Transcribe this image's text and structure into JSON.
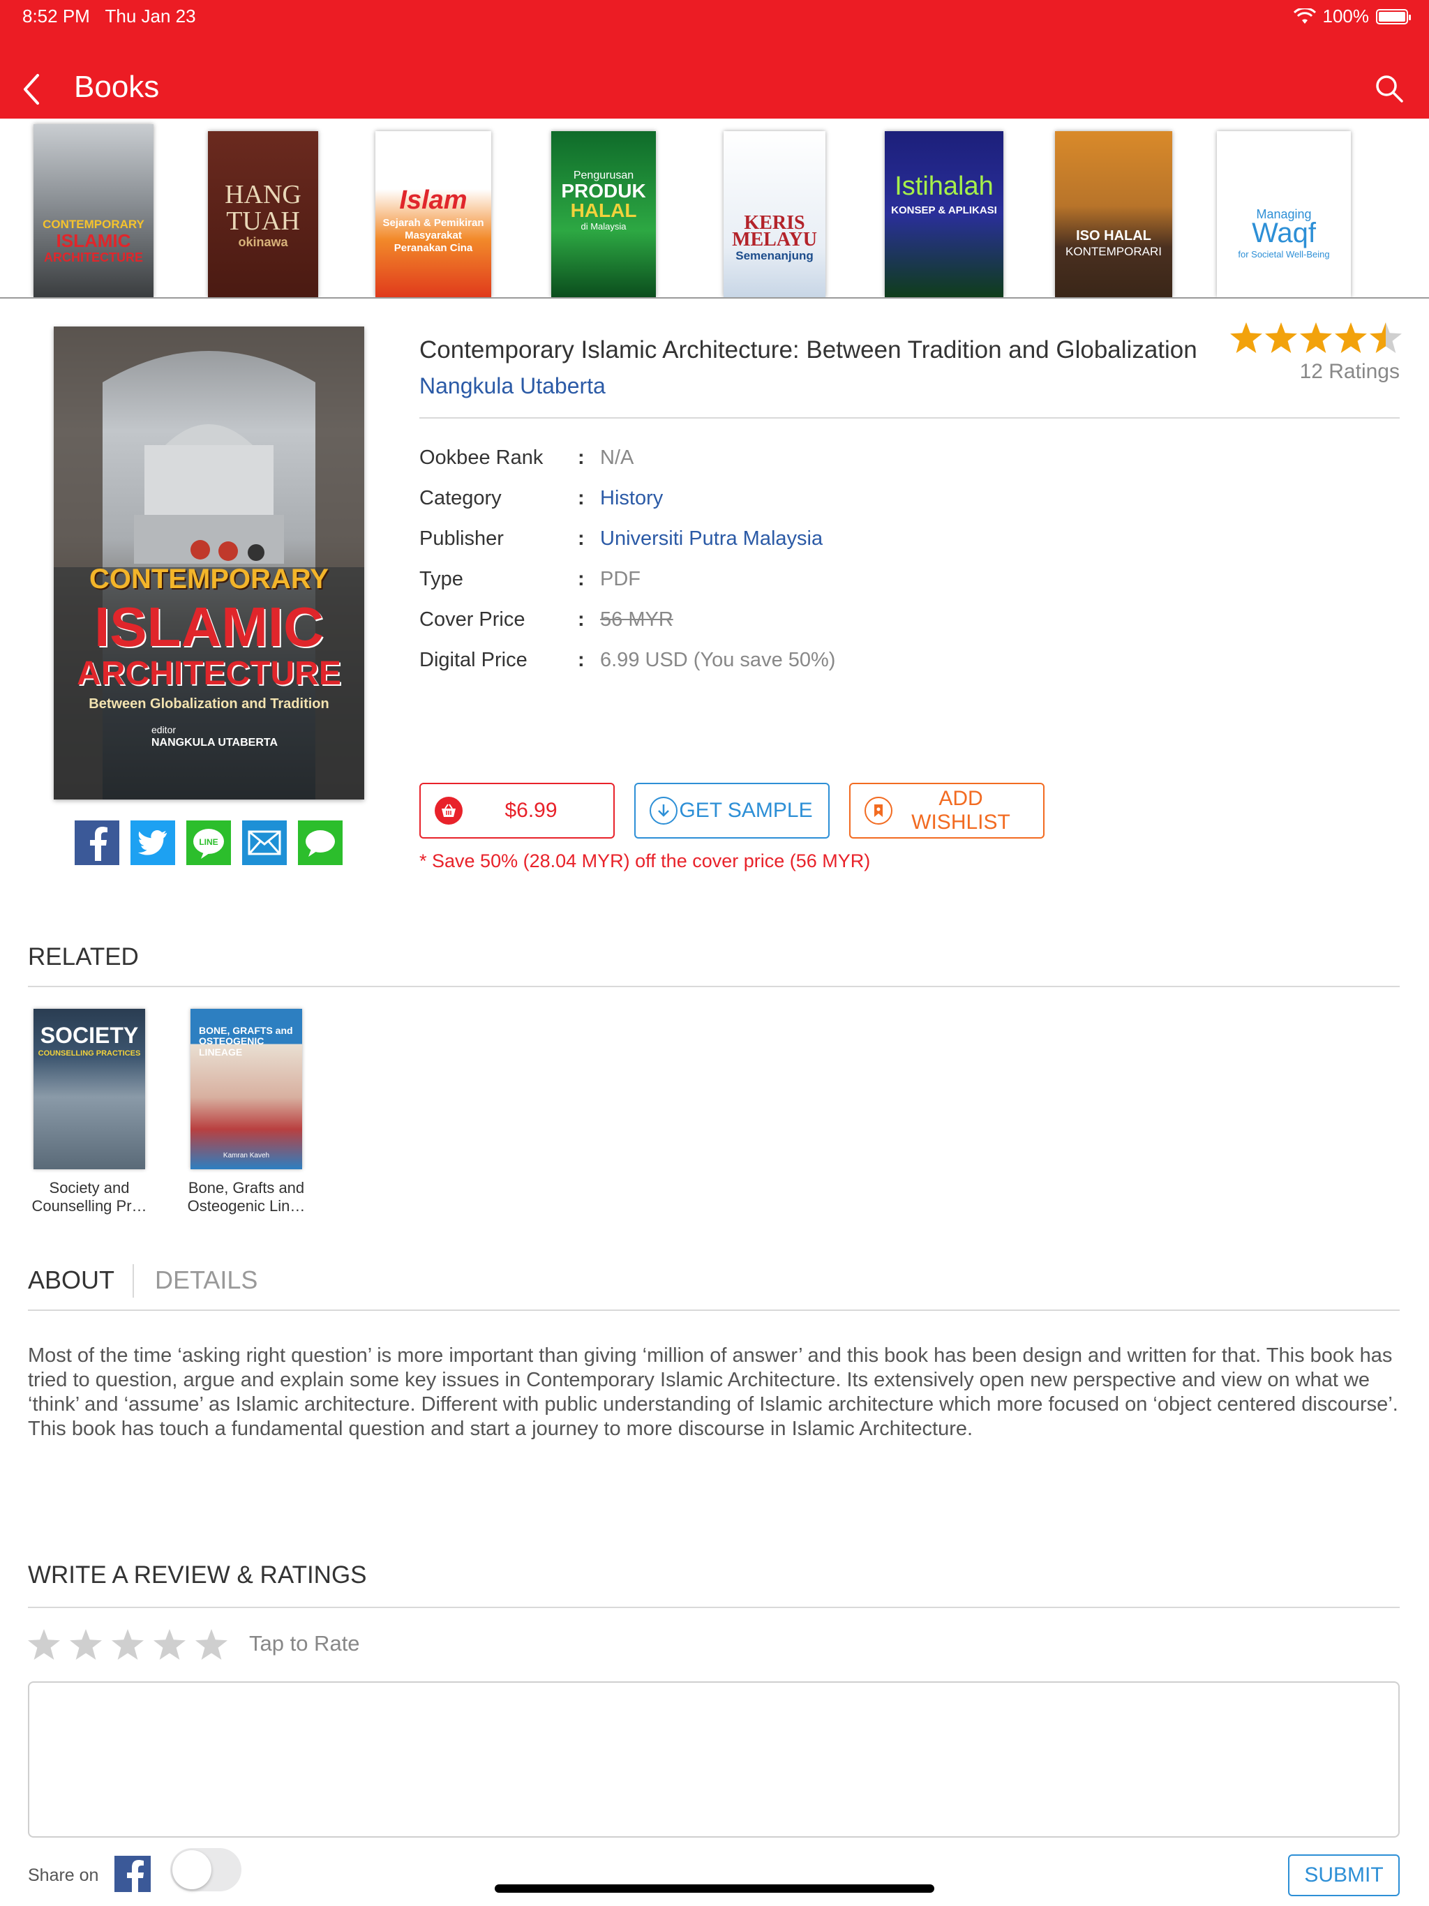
{
  "status_bar": {
    "time": "8:52 PM",
    "date": "Thu Jan 23",
    "battery": "100%"
  },
  "nav": {
    "title": "Books"
  },
  "carousel": [
    {
      "title": "Contemporary Islamic Architecture",
      "lines": [
        "CONTEMPORARY",
        "ISLAMIC",
        "ARCHITECTURE"
      ]
    },
    {
      "title": "Hang Tuah",
      "lines": [
        "HANG",
        "TUAH",
        "okinawa"
      ]
    },
    {
      "title": "Islam Sejarah & Pemikiran",
      "lines": [
        "Islam",
        "Sejarah & Pemikiran",
        "Masyarakat",
        "Peranakan Cina"
      ]
    },
    {
      "title": "Pengurusan Produk Halal",
      "lines": [
        "Pengurusan",
        "PRODUK",
        "HALAL",
        "di Malaysia"
      ]
    },
    {
      "title": "Keris Melayu Semenanjung",
      "lines": [
        "KERIS",
        "MELAYU",
        "Semenanjung"
      ]
    },
    {
      "title": "Istihalah Konsep & Aplikasi",
      "lines": [
        "Istihalah",
        "KONSEP & APLIKASI"
      ]
    },
    {
      "title": "ISO Halal Kontemporari",
      "lines": [
        "ISO HALAL",
        "KONTEMPORARI"
      ]
    },
    {
      "title": "Managing Waqf",
      "lines": [
        "Managing",
        "Waqf",
        "for Societal Well-Being"
      ]
    }
  ],
  "book": {
    "title": "Contemporary Islamic Architecture: Between Tradition and Globalization",
    "author": "Nangkula Utaberta",
    "rating": 4.5,
    "ratings_count": "12 Ratings",
    "cover": {
      "line1": "CONTEMPORARY",
      "line2": "ISLAMIC",
      "line3": "ARCHITECTURE",
      "subtitle": "Between Globalization and Tradition",
      "editor_label": "editor",
      "editor": "NANGKULA UTABERTA"
    },
    "info": [
      {
        "label": "Ookbee Rank",
        "value": "N/A"
      },
      {
        "label": "Category",
        "value": "History"
      },
      {
        "label": "Publisher",
        "value": "Universiti Putra Malaysia"
      },
      {
        "label": "Type",
        "value": "PDF"
      },
      {
        "label": "Cover Price",
        "value": "56 MYR"
      },
      {
        "label": "Digital Price",
        "value": "6.99 USD (You save 50%)"
      }
    ],
    "colon": ":",
    "buy_label": "$6.99",
    "sample_label": "GET SAMPLE",
    "wishlist_label": "ADD WISHLIST",
    "save_note": "* Save 50% (28.04 MYR) off the cover price (56 MYR)"
  },
  "share_icons": [
    "facebook-icon",
    "twitter-icon",
    "line-icon",
    "mail-icon",
    "message-icon"
  ],
  "related": {
    "heading": "RELATED",
    "items": [
      {
        "title_line1": "Society and",
        "title_line2": "Counselling Pr…",
        "cover_text": "SOCIETY",
        "cover_sub": "COUNSELLING PRACTICES"
      },
      {
        "title_line1": "Bone, Grafts and",
        "title_line2": "Osteogenic Lin…",
        "cover_text": "BONE, GRAFTS and OSTEOGENIC LINEAGE",
        "cover_sub": "Kamran Kaveh"
      }
    ]
  },
  "tabs": {
    "about": "ABOUT",
    "details": "DETAILS"
  },
  "about_text": "Most of the time ‘asking right question’ is more important than giving ‘million of answer’ and this book has been design and written for that. This book has tried to question, argue and explain some key issues in Contemporary Islamic Architecture. Its extensively open new perspective and view on what we ‘think’ and ‘assume’ as Islamic architecture. Different with public understanding of Islamic architecture which more focused on ‘object centered discourse’. This book has touch a fundamental question and start a journey to more discourse in Islamic Architecture.",
  "review": {
    "heading": "WRITE A REVIEW & RATINGS",
    "tap_to_rate": "Tap to Rate",
    "text_value": "",
    "share_on": "Share on",
    "share_toggle_on": false,
    "submit_label": "SUBMIT"
  },
  "colors": {
    "brand_red": "#ec1c24",
    "link_blue": "#2b5aa6",
    "sample_blue": "#2d8fd6",
    "wishlist_orange": "#f26b21",
    "star_gold": "#f2a20c"
  }
}
